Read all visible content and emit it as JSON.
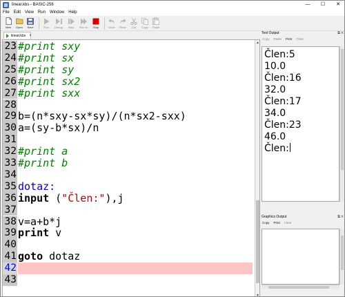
{
  "window": {
    "title": "linear.kbs - BASIC-256",
    "controls": [
      "—",
      "☐",
      "✕"
    ]
  },
  "menu": [
    "File",
    "Edit",
    "View",
    "Run",
    "Window",
    "Help"
  ],
  "toolbar": [
    {
      "label": "New",
      "icon": "new-icon",
      "enabled": true
    },
    {
      "label": "Open",
      "icon": "open-icon",
      "enabled": true
    },
    {
      "label": "Save",
      "icon": "save-icon",
      "enabled": true
    },
    {
      "label": "Run",
      "icon": "run-icon",
      "enabled": false
    },
    {
      "label": "Debug",
      "icon": "debug-icon",
      "enabled": false
    },
    {
      "label": "Step",
      "icon": "step-icon",
      "enabled": false
    },
    {
      "label": "Run to",
      "icon": "run-to-icon",
      "enabled": false
    },
    {
      "label": "Stop",
      "icon": "stop-icon",
      "enabled": true,
      "color": "#d00000"
    },
    {
      "label": "Undo",
      "icon": "undo-icon",
      "enabled": false
    },
    {
      "label": "Redo",
      "icon": "redo-icon",
      "enabled": false
    },
    {
      "label": "Cut",
      "icon": "cut-icon",
      "enabled": false
    },
    {
      "label": "Copy",
      "icon": "copy-icon",
      "enabled": false
    },
    {
      "label": "Paste",
      "icon": "paste-icon",
      "enabled": false
    }
  ],
  "editor_tab": {
    "label": "linear.kbs",
    "close": "×"
  },
  "editor": {
    "current_line": "42",
    "lines": [
      {
        "num": "23",
        "text": "#print sxy",
        "kind": "comment"
      },
      {
        "num": "24",
        "text": "#print sx",
        "kind": "comment"
      },
      {
        "num": "25",
        "text": "#print sy",
        "kind": "comment"
      },
      {
        "num": "26",
        "text": "#print sx2",
        "kind": "comment"
      },
      {
        "num": "27",
        "text": "#print sxx",
        "kind": "comment"
      },
      {
        "num": "28",
        "text": "",
        "kind": "plain"
      },
      {
        "num": "29",
        "text": "b=(n*sxy-sx*sy)/(n*sx2-sxx)",
        "kind": "plain"
      },
      {
        "num": "30",
        "text": "a=(sy-b*sx)/n",
        "kind": "plain"
      },
      {
        "num": "31",
        "text": "",
        "kind": "plain"
      },
      {
        "num": "32",
        "text": "#print a",
        "kind": "comment"
      },
      {
        "num": "33",
        "text": "#print b",
        "kind": "comment"
      },
      {
        "num": "34",
        "text": "",
        "kind": "plain"
      },
      {
        "num": "35",
        "text": "dotaz:",
        "kind": "label"
      },
      {
        "num": "36",
        "kw": "input",
        "mid": " (",
        "str": "\"Člen:\"",
        "rest": "),j",
        "kind": "input"
      },
      {
        "num": "37",
        "text": "",
        "kind": "plain"
      },
      {
        "num": "38",
        "text": "v=a+b*j",
        "kind": "plain"
      },
      {
        "num": "39",
        "kw": "print",
        "rest": " v",
        "kind": "kwline"
      },
      {
        "num": "40",
        "text": "",
        "kind": "plain"
      },
      {
        "num": "41",
        "kw": "goto",
        "rest": " dotaz",
        "kind": "kwline"
      },
      {
        "num": "42",
        "text": "",
        "kind": "current"
      },
      {
        "num": "43",
        "text": "",
        "kind": "plain"
      }
    ]
  },
  "text_output": {
    "title": "Text Output",
    "toolbar": [
      {
        "label": "Copy",
        "enabled": false
      },
      {
        "label": "Paste",
        "enabled": false
      },
      {
        "label": "Print",
        "enabled": true
      },
      {
        "label": "Clear",
        "enabled": false
      }
    ],
    "lines": [
      "Člen:5",
      "10.0",
      "Člen:16",
      "32.0",
      "Člen:17",
      "34.0",
      "Člen:23",
      "46.0",
      "Člen:"
    ]
  },
  "graphics_output": {
    "title": "Graphics Output",
    "toolbar": [
      {
        "label": "Copy",
        "enabled": true
      },
      {
        "label": "Print",
        "enabled": true
      },
      {
        "label": "Clear",
        "enabled": false
      }
    ]
  },
  "panel_controls": "⧉ ✕"
}
